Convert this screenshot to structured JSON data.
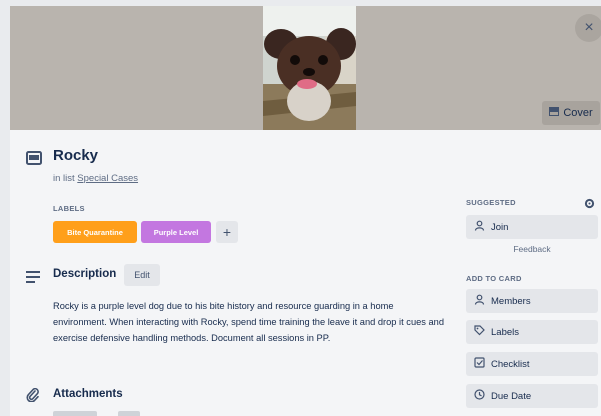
{
  "card": {
    "title": "Rocky",
    "list_prefix": "in list",
    "list_name": "Special Cases",
    "cover_button": "Cover",
    "close_symbol": "×"
  },
  "labels": {
    "heading": "LABELS",
    "items": [
      {
        "text": "Bite Quarantine",
        "color": "#ff9f1a"
      },
      {
        "text": "Purple Level",
        "color": "#c377e0"
      }
    ],
    "add_symbol": "+"
  },
  "description": {
    "heading": "Description",
    "edit_label": "Edit",
    "body": "Rocky is a purple level dog due to his bite history and resource guarding in a home environment. When interacting with Rocky, spend time training the leave it and drop it cues and exercise defensive handling methods. Document all sessions in PP."
  },
  "attachments": {
    "heading": "Attachments"
  },
  "sidebar": {
    "suggested_heading": "SUGGESTED",
    "join_label": "Join",
    "feedback_label": "Feedback",
    "add_heading": "ADD TO CARD",
    "items": [
      {
        "label": "Members",
        "icon": "person-icon"
      },
      {
        "label": "Labels",
        "icon": "tag-icon"
      },
      {
        "label": "Checklist",
        "icon": "checklist-icon"
      },
      {
        "label": "Due Date",
        "icon": "clock-icon"
      }
    ]
  }
}
